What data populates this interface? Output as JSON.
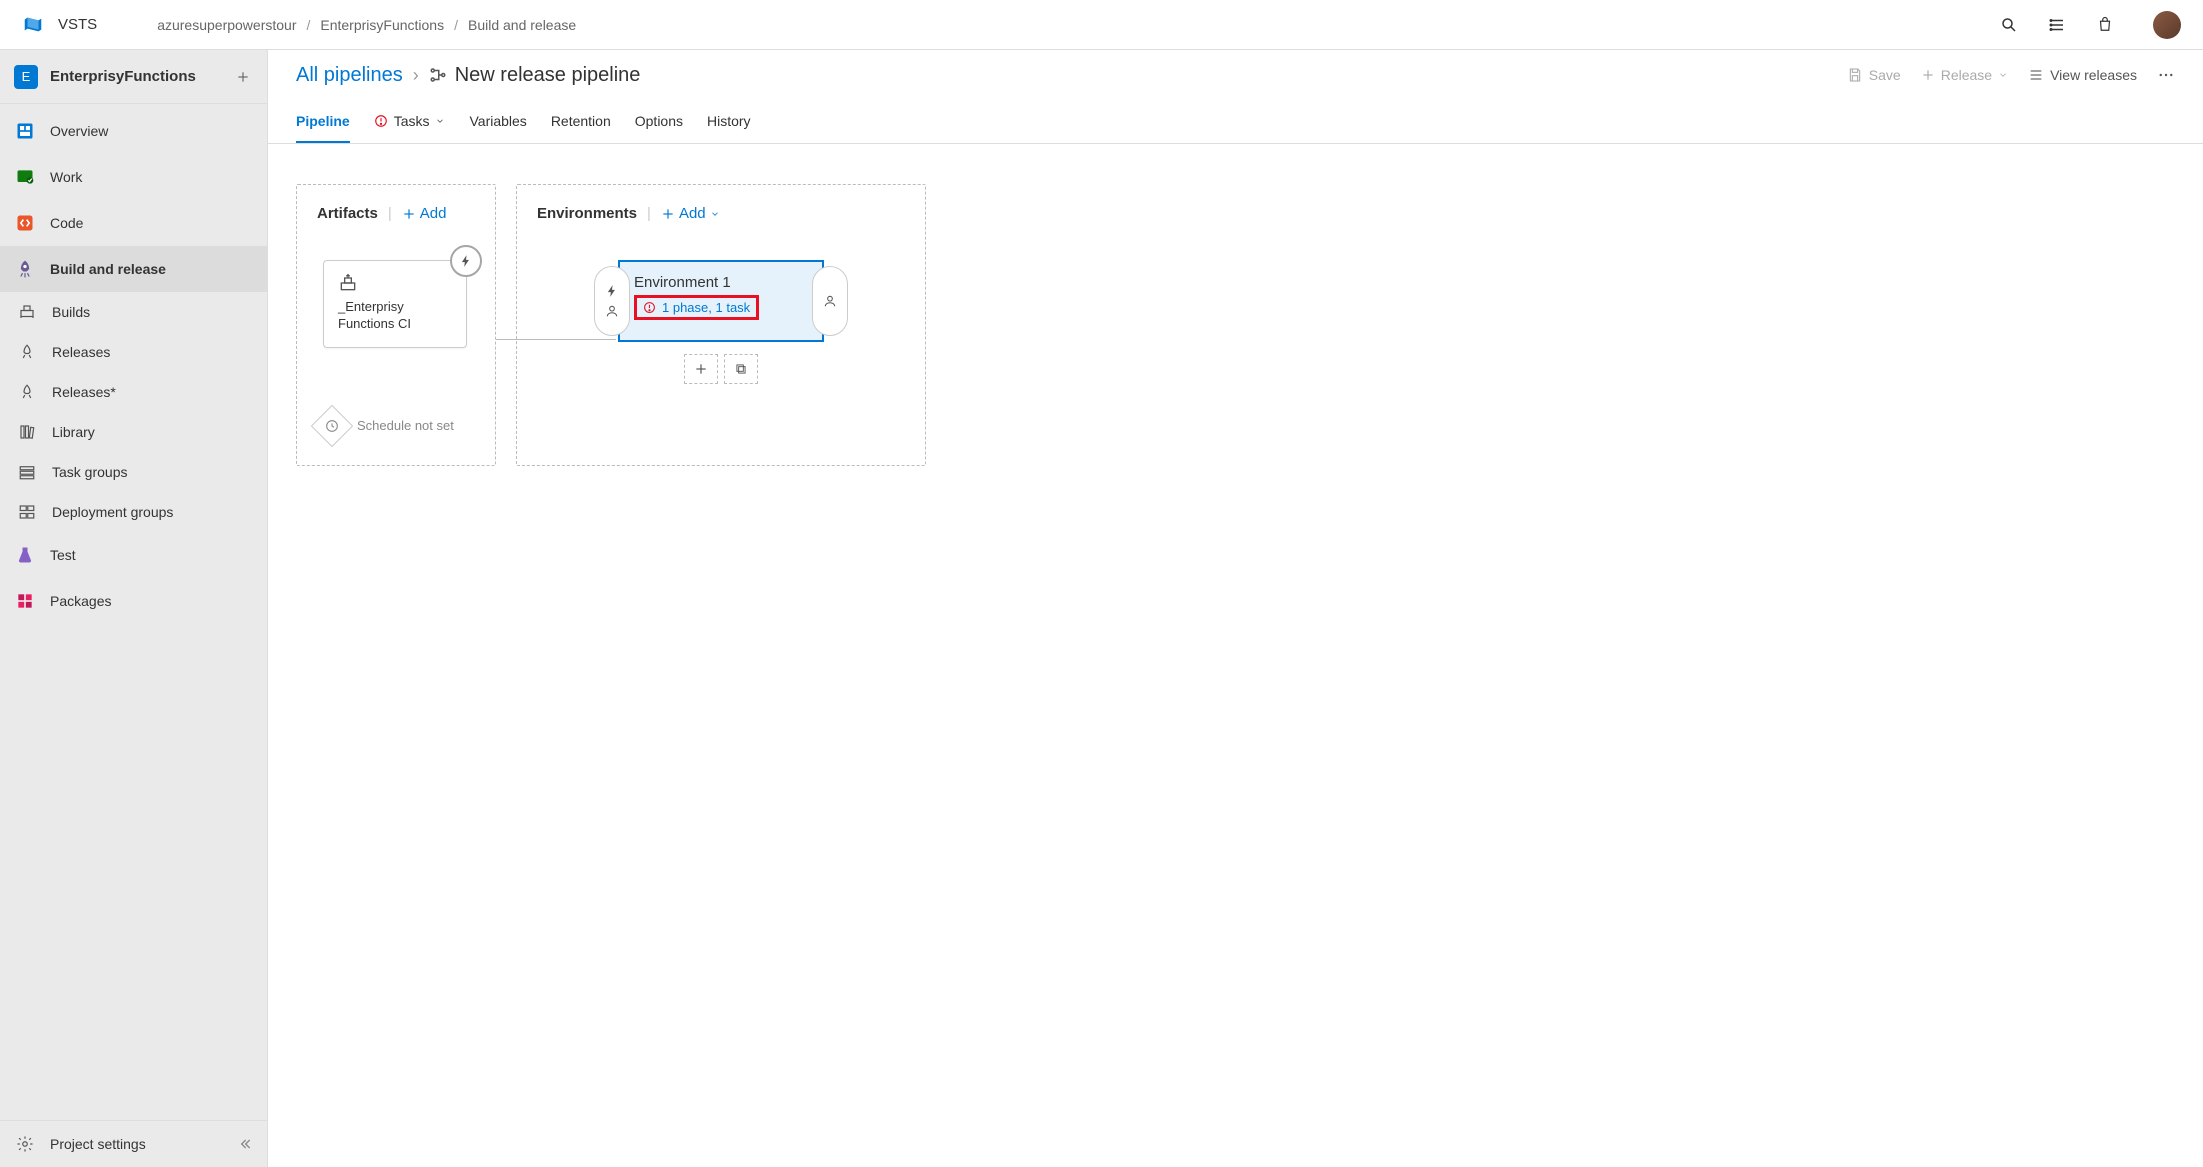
{
  "product": "VSTS",
  "breadcrumb": {
    "account": "azuresuperpowerstour",
    "project": "EnterprisyFunctions",
    "hub": "Build and release"
  },
  "sidebar": {
    "project_initial": "E",
    "project_name": "EnterprisyFunctions",
    "items": [
      {
        "label": "Overview"
      },
      {
        "label": "Work"
      },
      {
        "label": "Code"
      },
      {
        "label": "Build and release"
      },
      {
        "label": "Test"
      },
      {
        "label": "Packages"
      }
    ],
    "sub_items": [
      {
        "label": "Builds"
      },
      {
        "label": "Releases"
      },
      {
        "label": "Releases*"
      },
      {
        "label": "Library"
      },
      {
        "label": "Task groups"
      },
      {
        "label": "Deployment groups"
      }
    ],
    "settings_label": "Project settings"
  },
  "header": {
    "all_pipelines": "All pipelines",
    "title": "New release pipeline"
  },
  "toolbar": {
    "save": "Save",
    "release": "Release",
    "view_releases": "View releases"
  },
  "tabs": {
    "pipeline": "Pipeline",
    "tasks": "Tasks",
    "variables": "Variables",
    "retention": "Retention",
    "options": "Options",
    "history": "History"
  },
  "canvas": {
    "artifacts_title": "Artifacts",
    "environments_title": "Environments",
    "add_label": "Add",
    "artifact_name": "_Enterprisy Functions CI",
    "schedule_text": "Schedule not set",
    "env_name": "Environment 1",
    "env_status": "1 phase, 1 task"
  }
}
